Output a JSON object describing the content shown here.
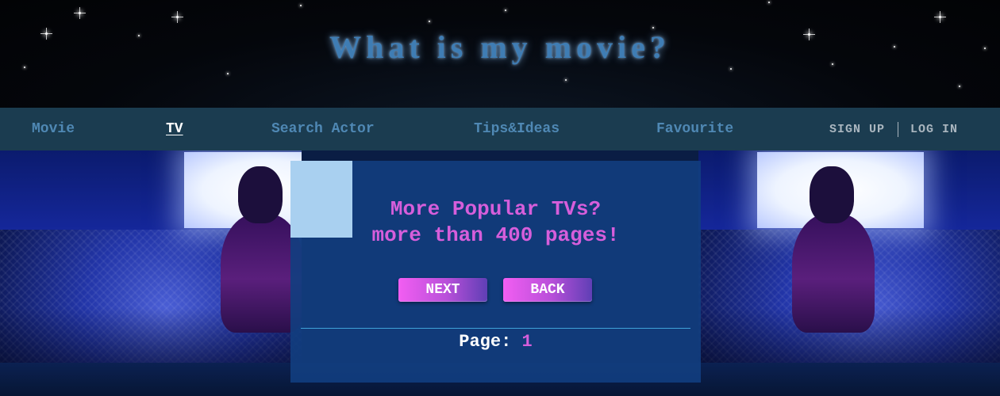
{
  "site": {
    "title": "What is my movie?"
  },
  "nav": {
    "items": [
      {
        "label": "Movie",
        "active": false
      },
      {
        "label": "TV",
        "active": true
      },
      {
        "label": "Search Actor",
        "active": false
      },
      {
        "label": "Tips&Ideas",
        "active": false
      },
      {
        "label": "Favourite",
        "active": false
      }
    ],
    "auth": {
      "signup_label": "SIGN UP",
      "separator": "|",
      "login_label": "LOG IN"
    }
  },
  "panel": {
    "heading_line1": "More Popular TVs?",
    "heading_line2": "more than 400 pages!",
    "next_label": "NEXT",
    "back_label": "BACK",
    "page_label": "Page:",
    "page_number": "1"
  },
  "colors": {
    "nav_background": "#1b3c50",
    "nav_link": "#4f88b4",
    "title_glow": "#3f7db4",
    "panel_background": "#123e80",
    "heading_magenta": "#d65edb",
    "button_gradient_start": "#f25ef2",
    "button_gradient_end": "#5f3fb5"
  },
  "icons": {
    "header_decoration": "stars"
  }
}
